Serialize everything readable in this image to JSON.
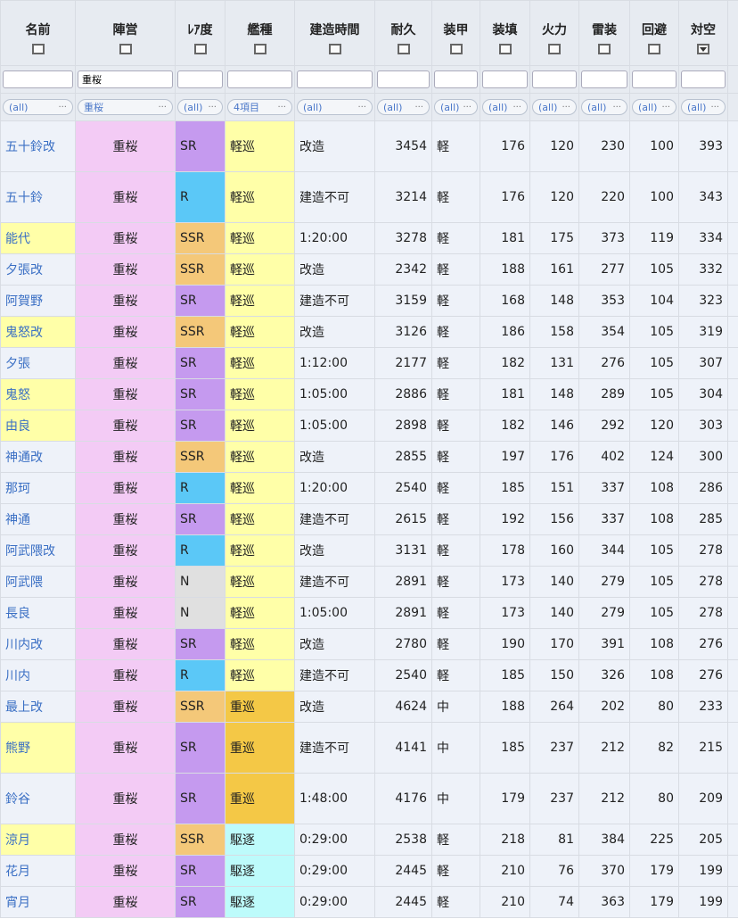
{
  "headers": [
    "名前",
    "陣営",
    "ﾚｱ度",
    "艦種",
    "建造時間",
    "耐久",
    "装甲",
    "装填",
    "火力",
    "雷装",
    "回避",
    "対空"
  ],
  "filter_inputs": [
    "",
    "重桜",
    "",
    "",
    "",
    "",
    "",
    "",
    "",
    "",
    "",
    ""
  ],
  "selects": [
    "(all)",
    "重桜",
    "(all)",
    "4項目",
    "(all)",
    "(all)",
    "(all)",
    "(all)",
    "(all)",
    "(all)",
    "(all)",
    "(all)"
  ],
  "rows": [
    {
      "name": "五十鈴改",
      "hl": false,
      "faction": "重桜",
      "rarity": "SR",
      "type": "軽巡",
      "tc": "light",
      "time": "改造",
      "hp": "3454",
      "armor": "軽",
      "reload": "176",
      "fire": "120",
      "torp": "230",
      "eva": "100",
      "aa": "393",
      "tall": true
    },
    {
      "name": "五十鈴",
      "hl": false,
      "faction": "重桜",
      "rarity": "R",
      "type": "軽巡",
      "tc": "light",
      "time": "建造不可",
      "hp": "3214",
      "armor": "軽",
      "reload": "176",
      "fire": "120",
      "torp": "220",
      "eva": "100",
      "aa": "343",
      "tall": true
    },
    {
      "name": "能代",
      "hl": true,
      "faction": "重桜",
      "rarity": "SSR",
      "type": "軽巡",
      "tc": "light",
      "time": "1:20:00",
      "hp": "3278",
      "armor": "軽",
      "reload": "181",
      "fire": "175",
      "torp": "373",
      "eva": "119",
      "aa": "334",
      "tall": false
    },
    {
      "name": "夕張改",
      "hl": false,
      "faction": "重桜",
      "rarity": "SSR",
      "type": "軽巡",
      "tc": "light",
      "time": "改造",
      "hp": "2342",
      "armor": "軽",
      "reload": "188",
      "fire": "161",
      "torp": "277",
      "eva": "105",
      "aa": "332",
      "tall": false
    },
    {
      "name": "阿賀野",
      "hl": false,
      "faction": "重桜",
      "rarity": "SR",
      "type": "軽巡",
      "tc": "light",
      "time": "建造不可",
      "hp": "3159",
      "armor": "軽",
      "reload": "168",
      "fire": "148",
      "torp": "353",
      "eva": "104",
      "aa": "323",
      "tall": false
    },
    {
      "name": "鬼怒改",
      "hl": true,
      "faction": "重桜",
      "rarity": "SSR",
      "type": "軽巡",
      "tc": "light",
      "time": "改造",
      "hp": "3126",
      "armor": "軽",
      "reload": "186",
      "fire": "158",
      "torp": "354",
      "eva": "105",
      "aa": "319",
      "tall": false
    },
    {
      "name": "夕張",
      "hl": false,
      "faction": "重桜",
      "rarity": "SR",
      "type": "軽巡",
      "tc": "light",
      "time": "1:12:00",
      "hp": "2177",
      "armor": "軽",
      "reload": "182",
      "fire": "131",
      "torp": "276",
      "eva": "105",
      "aa": "307",
      "tall": false
    },
    {
      "name": "鬼怒",
      "hl": true,
      "faction": "重桜",
      "rarity": "SR",
      "type": "軽巡",
      "tc": "light",
      "time": "1:05:00",
      "hp": "2886",
      "armor": "軽",
      "reload": "181",
      "fire": "148",
      "torp": "289",
      "eva": "105",
      "aa": "304",
      "tall": false
    },
    {
      "name": "由良",
      "hl": true,
      "faction": "重桜",
      "rarity": "SR",
      "type": "軽巡",
      "tc": "light",
      "time": "1:05:00",
      "hp": "2898",
      "armor": "軽",
      "reload": "182",
      "fire": "146",
      "torp": "292",
      "eva": "120",
      "aa": "303",
      "tall": false
    },
    {
      "name": "神通改",
      "hl": false,
      "faction": "重桜",
      "rarity": "SSR",
      "type": "軽巡",
      "tc": "light",
      "time": "改造",
      "hp": "2855",
      "armor": "軽",
      "reload": "197",
      "fire": "176",
      "torp": "402",
      "eva": "124",
      "aa": "300",
      "tall": false
    },
    {
      "name": "那珂",
      "hl": false,
      "faction": "重桜",
      "rarity": "R",
      "type": "軽巡",
      "tc": "light",
      "time": "1:20:00",
      "hp": "2540",
      "armor": "軽",
      "reload": "185",
      "fire": "151",
      "torp": "337",
      "eva": "108",
      "aa": "286",
      "tall": false
    },
    {
      "name": "神通",
      "hl": false,
      "faction": "重桜",
      "rarity": "SR",
      "type": "軽巡",
      "tc": "light",
      "time": "建造不可",
      "hp": "2615",
      "armor": "軽",
      "reload": "192",
      "fire": "156",
      "torp": "337",
      "eva": "108",
      "aa": "285",
      "tall": false
    },
    {
      "name": "阿武隈改",
      "hl": false,
      "faction": "重桜",
      "rarity": "R",
      "type": "軽巡",
      "tc": "light",
      "time": "改造",
      "hp": "3131",
      "armor": "軽",
      "reload": "178",
      "fire": "160",
      "torp": "344",
      "eva": "105",
      "aa": "278",
      "tall": false
    },
    {
      "name": "阿武隈",
      "hl": false,
      "faction": "重桜",
      "rarity": "N",
      "type": "軽巡",
      "tc": "light",
      "time": "建造不可",
      "hp": "2891",
      "armor": "軽",
      "reload": "173",
      "fire": "140",
      "torp": "279",
      "eva": "105",
      "aa": "278",
      "tall": false
    },
    {
      "name": "長良",
      "hl": false,
      "faction": "重桜",
      "rarity": "N",
      "type": "軽巡",
      "tc": "light",
      "time": "1:05:00",
      "hp": "2891",
      "armor": "軽",
      "reload": "173",
      "fire": "140",
      "torp": "279",
      "eva": "105",
      "aa": "278",
      "tall": false
    },
    {
      "name": "川内改",
      "hl": false,
      "faction": "重桜",
      "rarity": "SR",
      "type": "軽巡",
      "tc": "light",
      "time": "改造",
      "hp": "2780",
      "armor": "軽",
      "reload": "190",
      "fire": "170",
      "torp": "391",
      "eva": "108",
      "aa": "276",
      "tall": false
    },
    {
      "name": "川内",
      "hl": false,
      "faction": "重桜",
      "rarity": "R",
      "type": "軽巡",
      "tc": "light",
      "time": "建造不可",
      "hp": "2540",
      "armor": "軽",
      "reload": "185",
      "fire": "150",
      "torp": "326",
      "eva": "108",
      "aa": "276",
      "tall": false
    },
    {
      "name": "最上改",
      "hl": false,
      "faction": "重桜",
      "rarity": "SSR",
      "type": "重巡",
      "tc": "heavy",
      "time": "改造",
      "hp": "4624",
      "armor": "中",
      "reload": "188",
      "fire": "264",
      "torp": "202",
      "eva": "80",
      "aa": "233",
      "tall": false
    },
    {
      "name": "熊野",
      "hl": true,
      "faction": "重桜",
      "rarity": "SR",
      "type": "重巡",
      "tc": "heavy",
      "time": "建造不可",
      "hp": "4141",
      "armor": "中",
      "reload": "185",
      "fire": "237",
      "torp": "212",
      "eva": "82",
      "aa": "215",
      "tall": true
    },
    {
      "name": "鈴谷",
      "hl": false,
      "faction": "重桜",
      "rarity": "SR",
      "type": "重巡",
      "tc": "heavy",
      "time": "1:48:00",
      "hp": "4176",
      "armor": "中",
      "reload": "179",
      "fire": "237",
      "torp": "212",
      "eva": "80",
      "aa": "209",
      "tall": true
    },
    {
      "name": "涼月",
      "hl": true,
      "faction": "重桜",
      "rarity": "SSR",
      "type": "駆逐",
      "tc": "dd",
      "time": "0:29:00",
      "hp": "2538",
      "armor": "軽",
      "reload": "218",
      "fire": "81",
      "torp": "384",
      "eva": "225",
      "aa": "205",
      "tall": false
    },
    {
      "name": "花月",
      "hl": false,
      "faction": "重桜",
      "rarity": "SR",
      "type": "駆逐",
      "tc": "dd",
      "time": "0:29:00",
      "hp": "2445",
      "armor": "軽",
      "reload": "210",
      "fire": "76",
      "torp": "370",
      "eva": "179",
      "aa": "199",
      "tall": false
    },
    {
      "name": "宵月",
      "hl": false,
      "faction": "重桜",
      "rarity": "SR",
      "type": "駆逐",
      "tc": "dd",
      "time": "0:29:00",
      "hp": "2445",
      "armor": "軽",
      "reload": "210",
      "fire": "74",
      "torp": "363",
      "eva": "179",
      "aa": "199",
      "tall": false
    }
  ]
}
